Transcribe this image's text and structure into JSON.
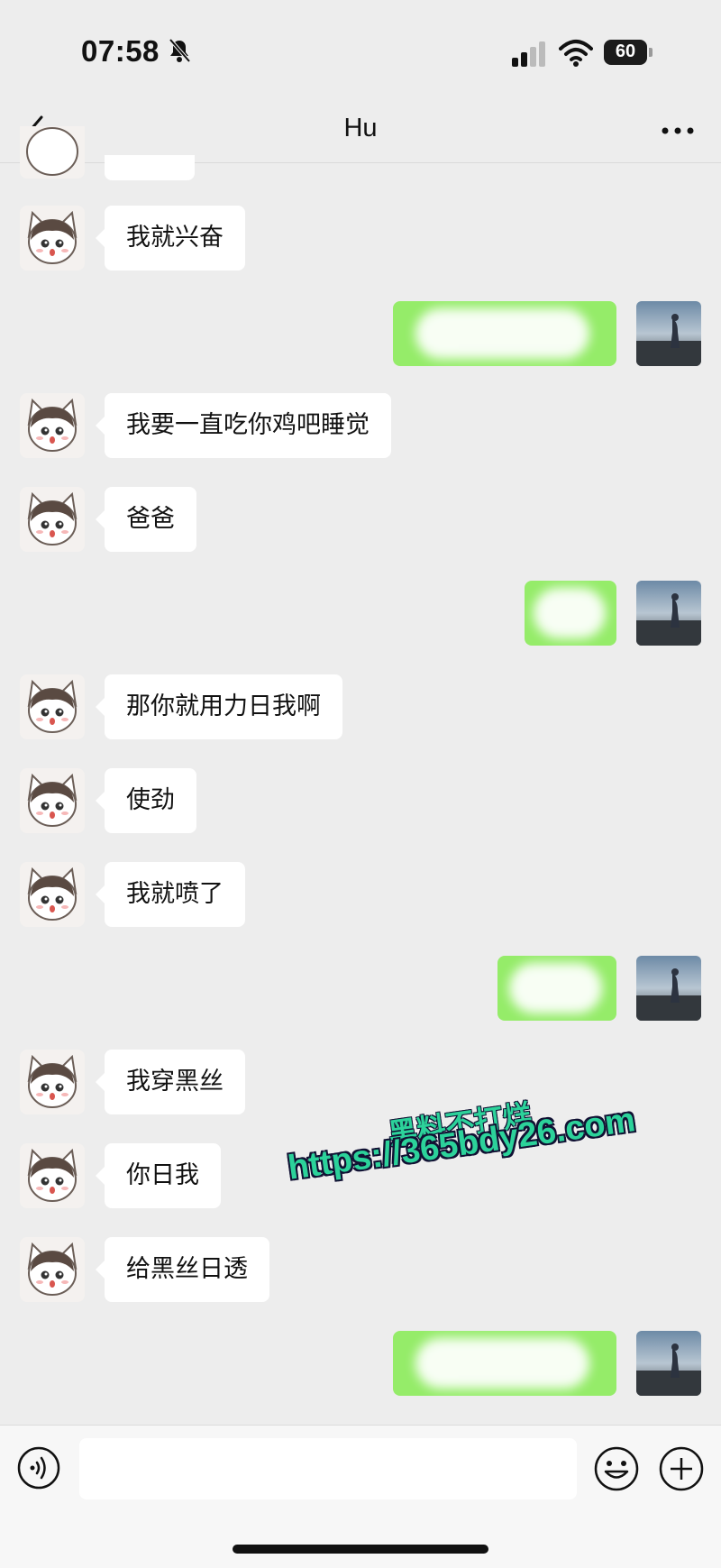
{
  "status_bar": {
    "time": "07:58",
    "battery": "60"
  },
  "nav": {
    "title": "Hu"
  },
  "messages": [
    {
      "from": "contact",
      "text": "我就兴奋"
    },
    {
      "from": "self",
      "text": ""
    },
    {
      "from": "contact",
      "text": "我要一直吃你鸡吧睡觉"
    },
    {
      "from": "contact",
      "text": "爸爸"
    },
    {
      "from": "self",
      "text": ""
    },
    {
      "from": "contact",
      "text": "那你就用力日我啊"
    },
    {
      "from": "contact",
      "text": "使劲"
    },
    {
      "from": "contact",
      "text": "我就喷了"
    },
    {
      "from": "self",
      "text": ""
    },
    {
      "from": "contact",
      "text": "我穿黑丝"
    },
    {
      "from": "contact",
      "text": "你日我"
    },
    {
      "from": "contact",
      "text": "给黑丝日透"
    },
    {
      "from": "self",
      "text": ""
    }
  ],
  "watermark": {
    "line1": "黑料不打烊",
    "line2": "https://365bdy26.com"
  },
  "input": {
    "placeholder": ""
  },
  "icons": {
    "back": "chevron-left-icon",
    "more": "more-dots-icon",
    "voice": "voice-icon",
    "emoji": "emoji-icon",
    "plus": "plus-icon",
    "bell_off": "bell-slash-icon",
    "signal": "signal-icon",
    "wifi": "wifi-icon"
  },
  "colors": {
    "self_bubble": "#95ec69",
    "contact_bubble": "#ffffff",
    "background": "#ededed"
  }
}
